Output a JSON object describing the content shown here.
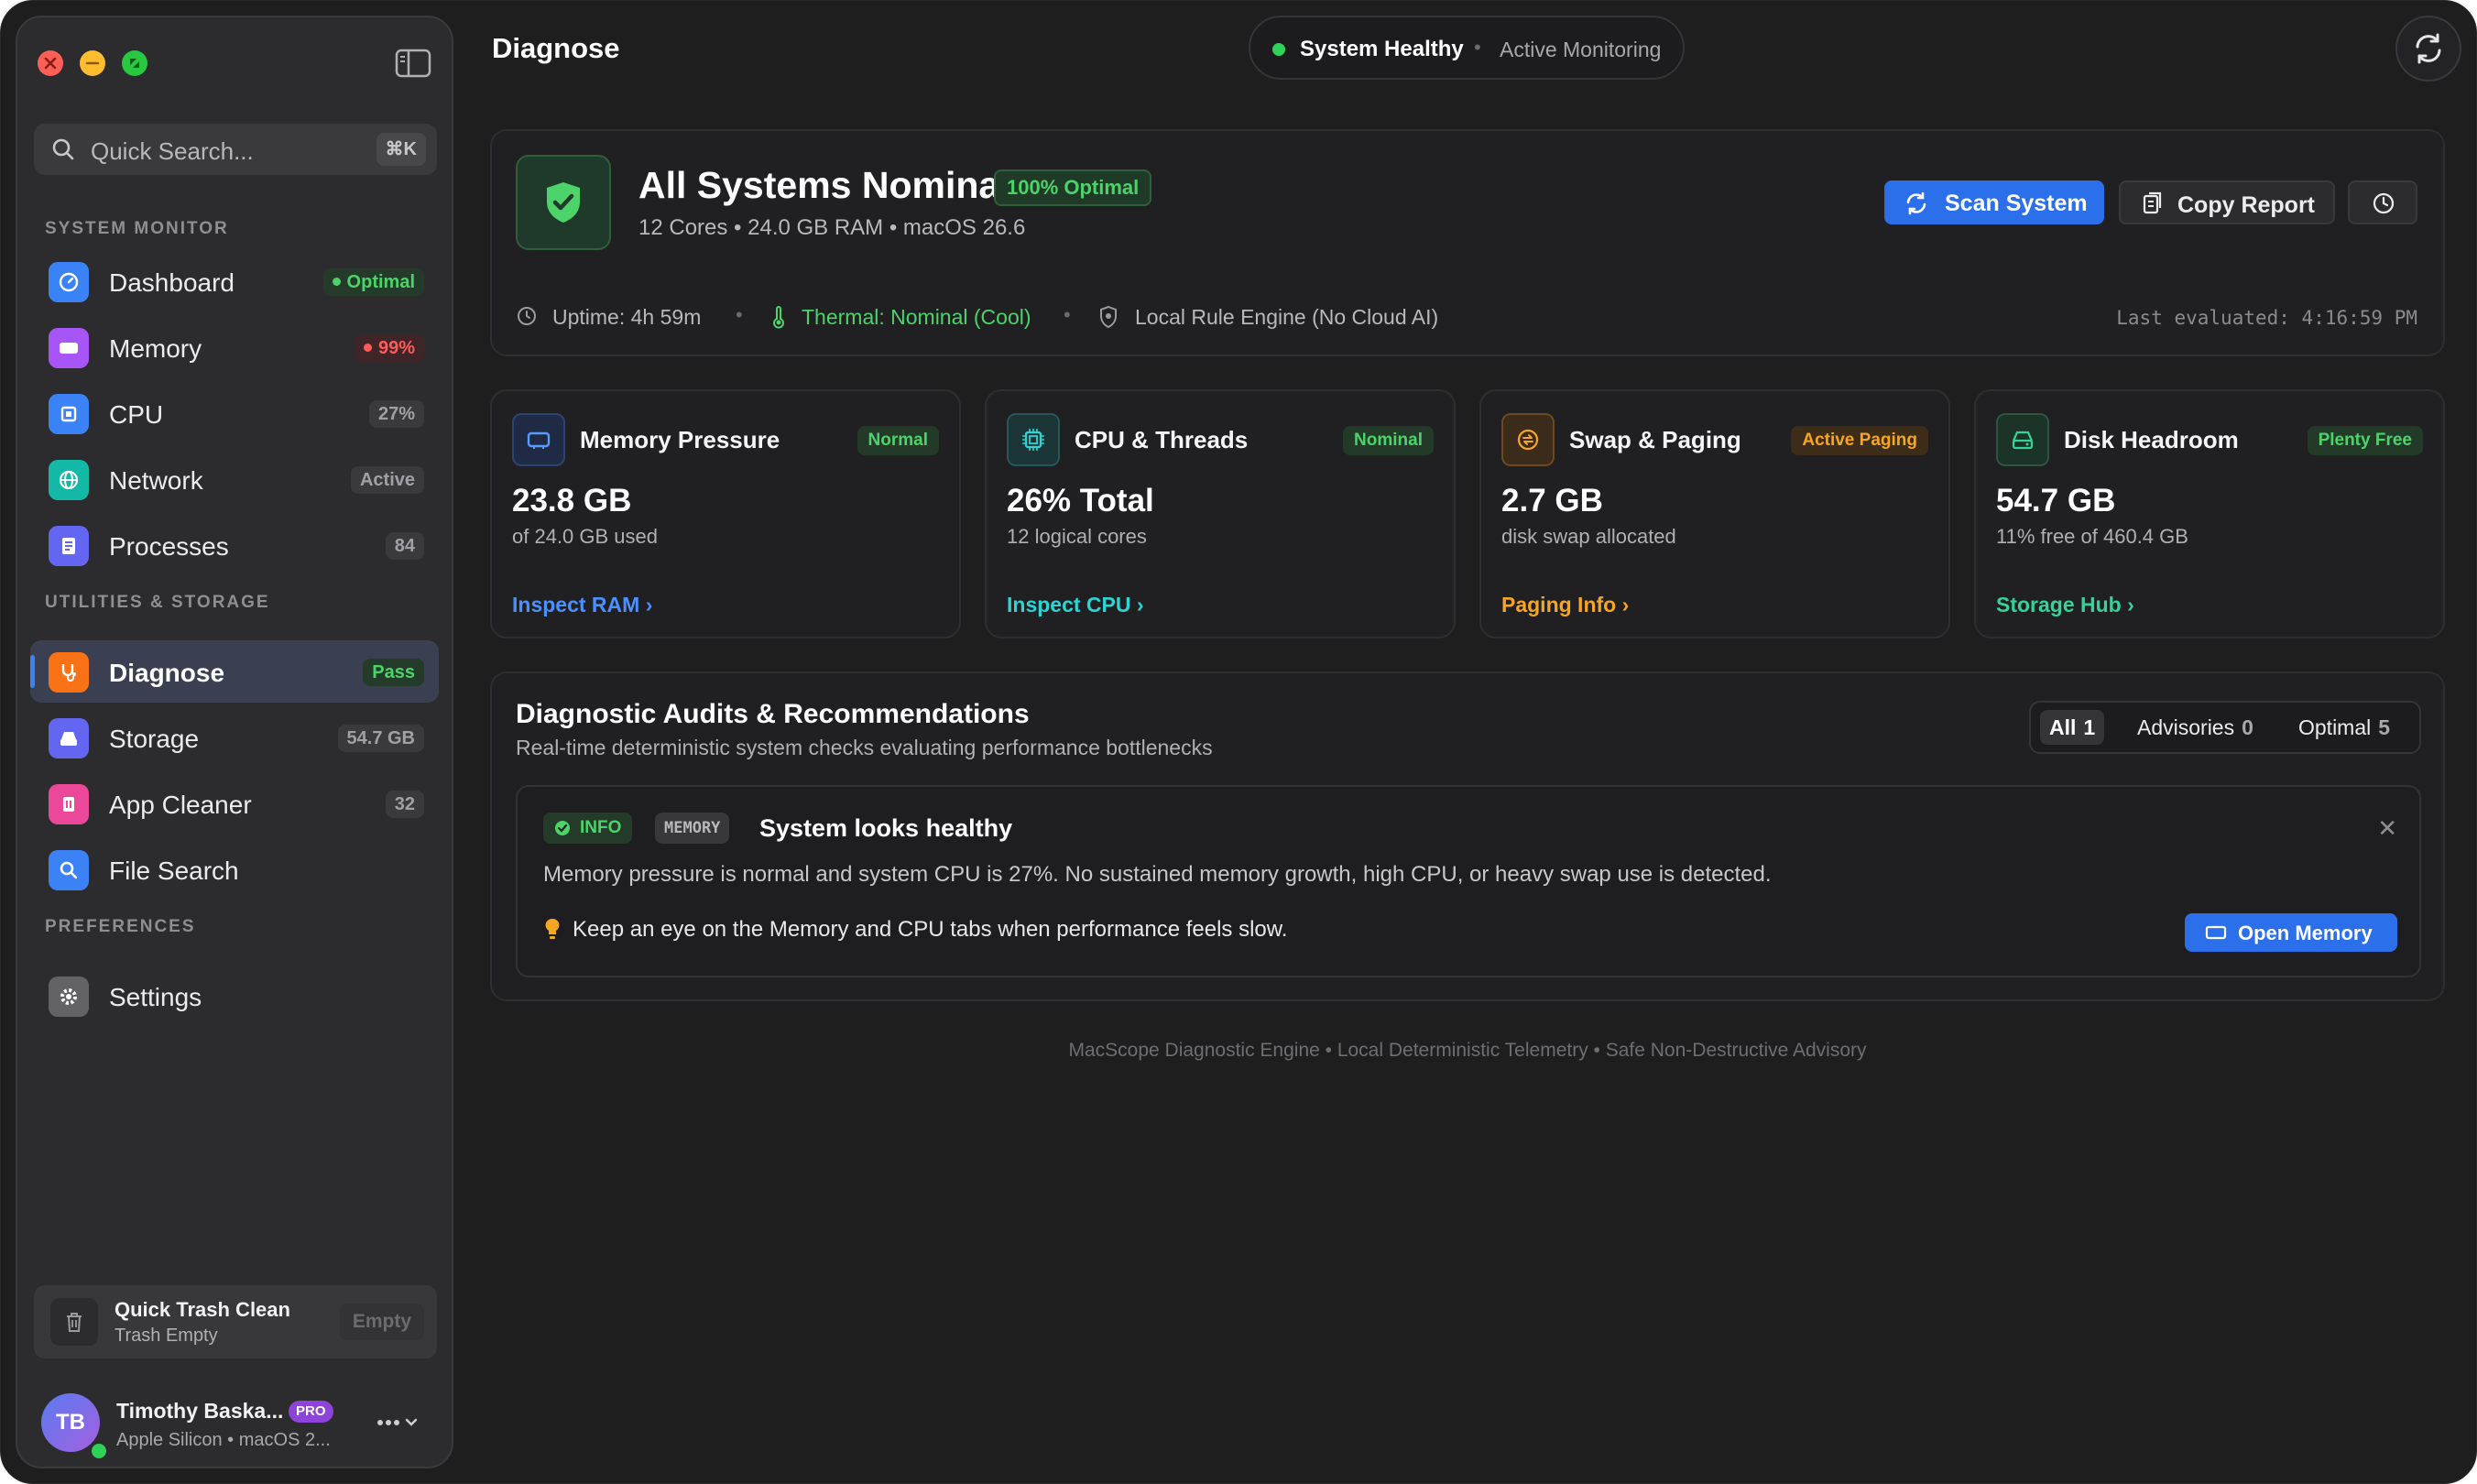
{
  "sidebar": {
    "search_placeholder": "Quick Search...",
    "search_shortcut": "⌘K",
    "sections": {
      "monitor": "SYSTEM MONITOR",
      "utilities": "UTILITIES & STORAGE",
      "preferences": "PREFERENCES"
    },
    "items": [
      {
        "label": "Dashboard",
        "badge": "Optimal",
        "badge_style": "green",
        "icon": "gauge-icon",
        "color": "#3b82f6"
      },
      {
        "label": "Memory",
        "badge": "99%",
        "badge_style": "red",
        "icon": "memory-chip-icon",
        "color": "#a855f7"
      },
      {
        "label": "CPU",
        "badge": "27%",
        "badge_style": "gray",
        "icon": "cpu-icon",
        "color": "#3b82f6"
      },
      {
        "label": "Network",
        "badge": "Active",
        "badge_style": "gray",
        "icon": "globe-icon",
        "color": "#14b8a6"
      },
      {
        "label": "Processes",
        "badge": "84",
        "badge_style": "gray",
        "icon": "list-icon",
        "color": "#6366f1"
      },
      {
        "label": "Diagnose",
        "badge": "Pass",
        "badge_style": "green",
        "icon": "stethoscope-icon",
        "color": "#f97316"
      },
      {
        "label": "Storage",
        "badge": "54.7 GB",
        "badge_style": "gray",
        "icon": "drive-icon",
        "color": "#6366f1"
      },
      {
        "label": "App Cleaner",
        "badge": "32",
        "badge_style": "gray",
        "icon": "trash-app-icon",
        "color": "#ec4899"
      },
      {
        "label": "File Search",
        "badge": "",
        "badge_style": "none",
        "icon": "magnifier-icon",
        "color": "#3b82f6"
      },
      {
        "label": "Settings",
        "badge": "",
        "badge_style": "none",
        "icon": "gear-icon",
        "color": "#636366"
      }
    ],
    "trash": {
      "title": "Quick Trash Clean",
      "subtitle": "Trash Empty",
      "button": "Empty"
    },
    "user": {
      "initials": "TB",
      "name": "Timothy Baska...",
      "plan": "PRO",
      "subtitle": "Apple Silicon • macOS 2..."
    }
  },
  "header": {
    "title": "Diagnose",
    "status_main": "System Healthy",
    "status_sub": "Active Monitoring"
  },
  "hero": {
    "title": "All Systems Nominal",
    "badge": "100% Optimal",
    "subtitle": "12 Cores • 24.0 GB RAM • macOS 26.6",
    "scan_label": "Scan System",
    "copy_label": "Copy Report",
    "uptime": "Uptime: 4h 59m",
    "thermal": "Thermal: Nominal (Cool)",
    "engine": "Local Rule Engine (No Cloud AI)",
    "last_evaluated": "Last evaluated: 4:16:59 PM"
  },
  "cards": [
    {
      "title": "Memory Pressure",
      "badge": "Normal",
      "value": "23.8 GB",
      "sub": "of 24.0 GB used",
      "link": "Inspect RAM",
      "accent": "#3b82f6"
    },
    {
      "title": "CPU & Threads",
      "badge": "Nominal",
      "value": "26% Total",
      "sub": "12 logical cores",
      "link": "Inspect CPU",
      "accent": "#22c5c5"
    },
    {
      "title": "Swap & Paging",
      "badge": "Active Paging",
      "value": "2.7 GB",
      "sub": "disk swap allocated",
      "link": "Paging Info",
      "accent": "#f59e0b"
    },
    {
      "title": "Disk Headroom",
      "badge": "Plenty Free",
      "value": "54.7 GB",
      "sub": "11% free of 460.4 GB",
      "link": "Storage Hub",
      "accent": "#34d399"
    }
  ],
  "audits": {
    "title": "Diagnostic Audits & Recommendations",
    "subtitle": "Real-time deterministic system checks evaluating performance bottlenecks",
    "filters": [
      {
        "label": "All",
        "count": "1"
      },
      {
        "label": "Advisories",
        "count": "0"
      },
      {
        "label": "Optimal",
        "count": "5"
      }
    ],
    "advisory": {
      "level": "INFO",
      "category": "MEMORY",
      "title": "System looks healthy",
      "description": "Memory pressure is normal and system CPU is 27%. No sustained memory growth, high CPU, or heavy swap use is detected.",
      "tip": "Keep an eye on the Memory and CPU tabs when performance feels slow.",
      "action": "Open Memory",
      "close": "✕"
    }
  },
  "footer": "MacScope Diagnostic Engine • Local Deterministic Telemetry • Safe Non-Destructive Advisory"
}
